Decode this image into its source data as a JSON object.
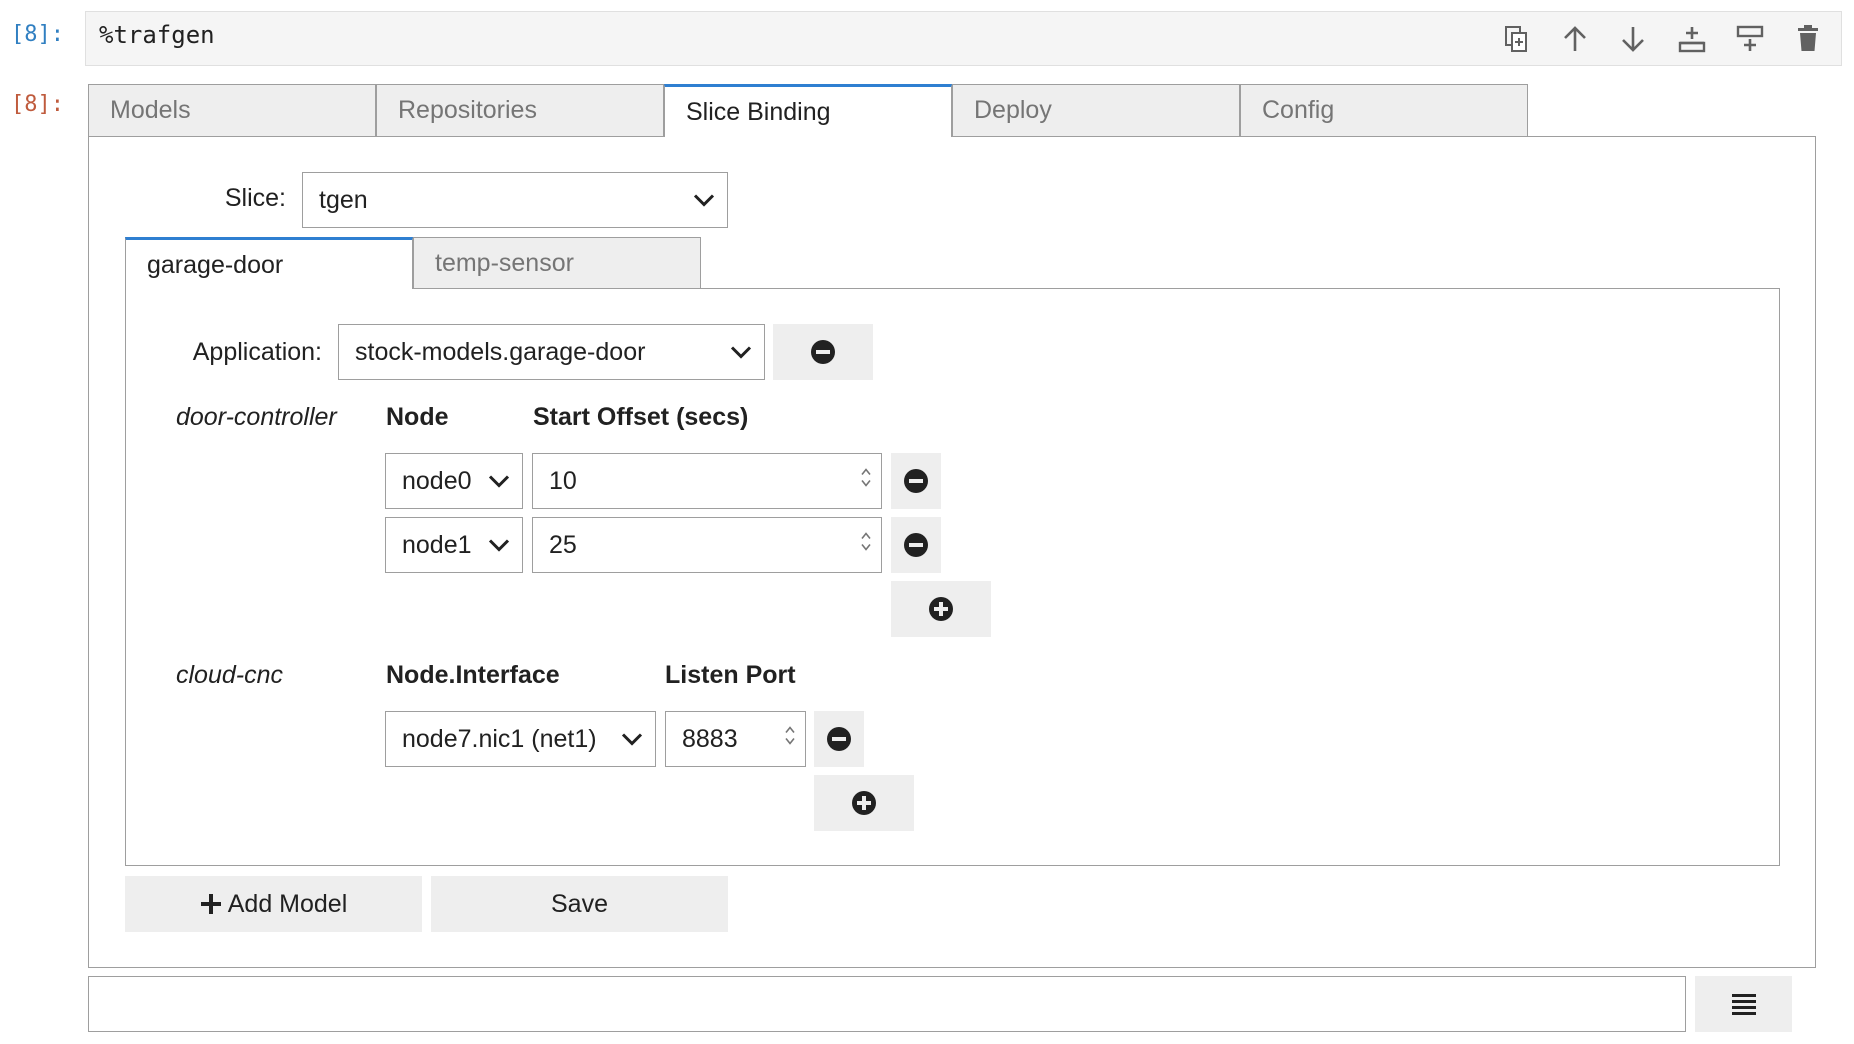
{
  "cell": {
    "input_prompt": "[8]:",
    "output_prompt": "[8]:",
    "code": "%trafgen",
    "toolbar_icons": [
      "duplicate-icon",
      "move-up-icon",
      "move-down-icon",
      "insert-below-icon",
      "insert-above-icon",
      "delete-icon"
    ]
  },
  "tabs": [
    {
      "label": "Models",
      "active": false
    },
    {
      "label": "Repositories",
      "active": false
    },
    {
      "label": "Slice Binding",
      "active": true
    },
    {
      "label": "Deploy",
      "active": false
    },
    {
      "label": "Config",
      "active": false
    }
  ],
  "slice": {
    "label": "Slice:",
    "value": "tgen"
  },
  "model_tabs": [
    {
      "label": "garage-door",
      "active": true
    },
    {
      "label": "temp-sensor",
      "active": false
    }
  ],
  "application": {
    "label": "Application:",
    "value": "stock-models.garage-door"
  },
  "door_controller": {
    "name": "door-controller",
    "col_node": "Node",
    "col_offset": "Start Offset (secs)",
    "rows": [
      {
        "node": "node0",
        "offset": "10"
      },
      {
        "node": "node1",
        "offset": "25"
      }
    ]
  },
  "cloud_cnc": {
    "name": "cloud-cnc",
    "col_iface": "Node.Interface",
    "col_port": "Listen Port",
    "rows": [
      {
        "iface": "node7.nic1 (net1)",
        "port": "8883"
      }
    ]
  },
  "buttons": {
    "add_model": "Add Model",
    "save": "Save"
  },
  "output_line": {
    "value": ""
  }
}
